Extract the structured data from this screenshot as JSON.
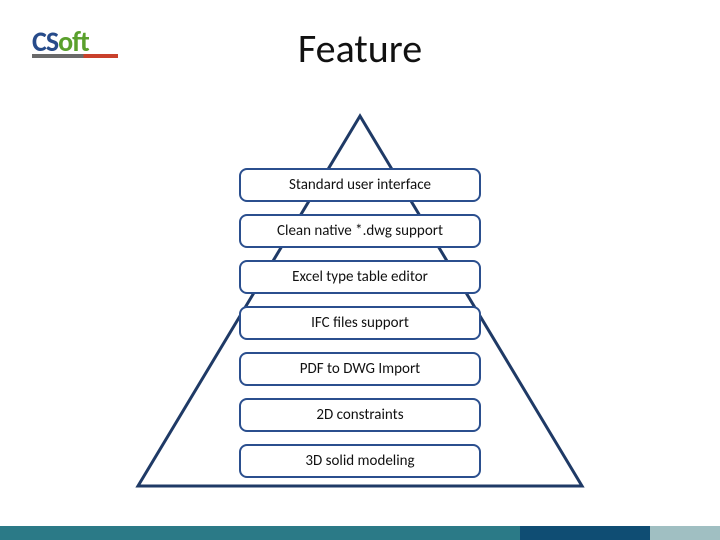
{
  "logo": {
    "part1": "CS",
    "part2": "oft"
  },
  "title": "Feature",
  "features": [
    "Standard user interface",
    "Clean native *.dwg support",
    "Excel type table editor",
    "IFC files support",
    "PDF to DWG Import",
    "2D constraints",
    "3D solid modeling"
  ],
  "colors": {
    "feature_border": "#2b4f8e",
    "triangle_stroke": "#1f3a66"
  }
}
